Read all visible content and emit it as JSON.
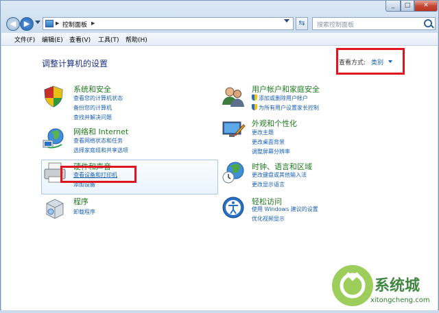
{
  "toolbar": {
    "breadcrumb": "控制面板",
    "search_placeholder": "搜索控制面板"
  },
  "menu": {
    "file": "文件(F)",
    "edit": "编辑(E)",
    "view": "查看(V)",
    "tools": "工具(T)",
    "help": "帮助(H)"
  },
  "main": {
    "title": "调整计算机的设置",
    "view_by_label": "查看方式:",
    "view_by_value": "类别"
  },
  "categories": {
    "system": {
      "title": "系统和安全",
      "links": [
        "查看您的计算机状态",
        "备份您的计算机",
        "查找并解决问题"
      ]
    },
    "network": {
      "title": "网络和 Internet",
      "links": [
        "查看网络状态和任务",
        "选择家庭组和共享选项"
      ]
    },
    "hardware": {
      "title": "硬件和声音",
      "links": [
        "查看设备和打印机",
        "添加设备"
      ]
    },
    "programs": {
      "title": "程序",
      "links": [
        "卸载程序"
      ]
    },
    "users": {
      "title": "用户帐户和家庭安全",
      "links": [
        "添加或删除用户帐户",
        "为所有用户设置家长控制"
      ]
    },
    "appearance": {
      "title": "外观和个性化",
      "links": [
        "更改主题",
        "更改桌面背景",
        "调整屏幕分辨率"
      ]
    },
    "clock": {
      "title": "时钟、语言和区域",
      "links": [
        "更改键盘或其他输入法",
        "更改显示语言"
      ]
    },
    "ease": {
      "title": "轻松访问",
      "links": [
        "使用 Windows 建议的设置",
        "优化视频显示"
      ]
    }
  },
  "watermark": {
    "brand": "系统城",
    "url": "xitongcheng.com"
  },
  "colors": {
    "category_title": "#1e7a1e",
    "link": "#1a5fb4",
    "highlight": "#e0141e"
  }
}
